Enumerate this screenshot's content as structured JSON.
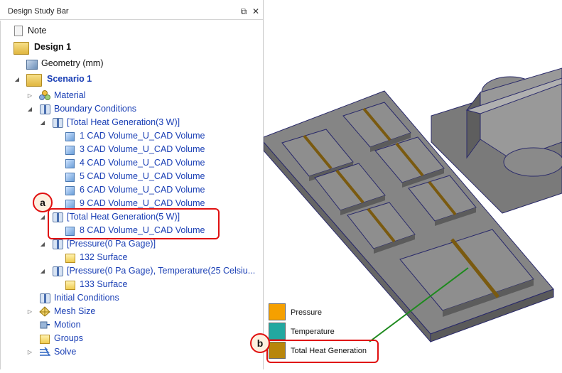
{
  "panel": {
    "title": "Design Study Bar",
    "float_icon": "⧉",
    "close_icon": "✕"
  },
  "tree": {
    "note": "Note",
    "design": "Design 1",
    "geometry": "Geometry (mm)",
    "scenario": "Scenario 1",
    "material": "Material",
    "boundary_conditions": "Boundary Conditions",
    "thg3": "[Total Heat Generation(3 W)]",
    "vol1": "1 CAD Volume_U_CAD Volume",
    "vol3": "3 CAD Volume_U_CAD Volume",
    "vol4": "4 CAD Volume_U_CAD Volume",
    "vol5": "5 CAD Volume_U_CAD Volume",
    "vol6": "6 CAD Volume_U_CAD Volume",
    "vol9": "9 CAD Volume_U_CAD Volume",
    "thg5": "[Total Heat Generation(5 W)]",
    "vol8": "8 CAD Volume_U_CAD Volume",
    "pressure": "[Pressure(0 Pa Gage)]",
    "surf132": "132 Surface",
    "pressure_temp": "[Pressure(0 Pa Gage), Temperature(25 Celsiu...",
    "surf133": "133 Surface",
    "initial_conditions": "Initial Conditions",
    "mesh_size": "Mesh Size",
    "motion": "Motion",
    "groups": "Groups",
    "solve": "Solve"
  },
  "callouts": {
    "a": "a",
    "b": "b",
    "color": "#e01010"
  },
  "legend": {
    "items": [
      {
        "label": "Pressure",
        "color": "#f5a000"
      },
      {
        "label": "Temperature",
        "color": "#22a8a0"
      },
      {
        "label": "Total Heat Generation",
        "color": "#b8860b"
      }
    ]
  }
}
